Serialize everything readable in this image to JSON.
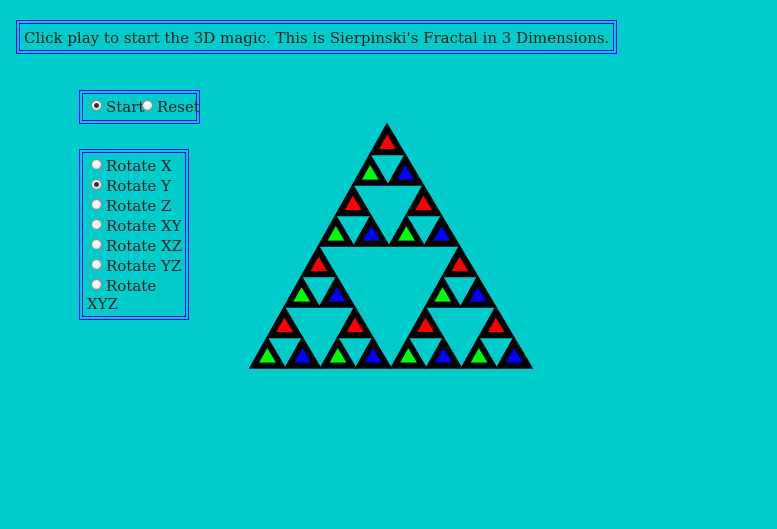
{
  "header": {
    "text": "Click play to start the 3D magic. This is Sierpinski's Fractal in 3 Dimensions."
  },
  "controls": {
    "start_label": "Start",
    "reset_label": "Reset"
  },
  "rotation": {
    "options": [
      "Rotate X",
      "Rotate Y",
      "Rotate Z",
      "Rotate XY",
      "Rotate XZ",
      "Rotate YZ",
      "Rotate"
    ],
    "last_wrap": "XYZ"
  },
  "colors": {
    "background": "#00cccc",
    "border": "#1a00ff",
    "fractal_outline": "#000000",
    "fractal_red": "#ff0000",
    "fractal_green": "#00ff00",
    "fractal_blue": "#0000ff"
  }
}
